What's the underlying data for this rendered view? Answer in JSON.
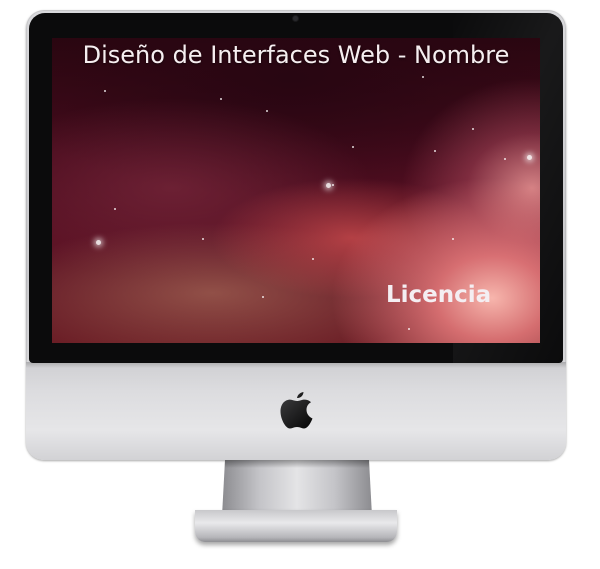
{
  "screen": {
    "title": "Diseño de Interfaces Web - Nombre",
    "license_link": "Licencia"
  },
  "device": {
    "logo_icon": "apple-logo-icon",
    "bezel_color": "#0b0b0c",
    "body_color": "#d4d4d7"
  }
}
